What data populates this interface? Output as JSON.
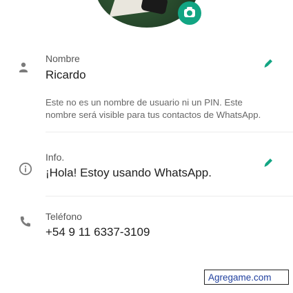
{
  "profile": {
    "camera_icon": "camera-icon"
  },
  "name_section": {
    "label": "Nombre",
    "value": "Ricardo",
    "description": "Este no es un nombre de usuario ni un PIN. Este nombre será visible para tus contactos de WhatsApp.",
    "icon": "person-icon",
    "edit_icon": "pencil-icon"
  },
  "info_section": {
    "label": "Info.",
    "value": "¡Hola! Estoy usando WhatsApp.",
    "icon": "info-icon",
    "edit_icon": "pencil-icon"
  },
  "phone_section": {
    "label": "Teléfono",
    "value": "+54 9 11 6337-3109",
    "icon": "phone-icon"
  },
  "watermark": {
    "text": "Agregame.com"
  },
  "colors": {
    "accent": "#12a583",
    "icon_gray": "#7b7b7b",
    "text_primary": "#1d1d1d",
    "text_secondary": "#666666"
  }
}
